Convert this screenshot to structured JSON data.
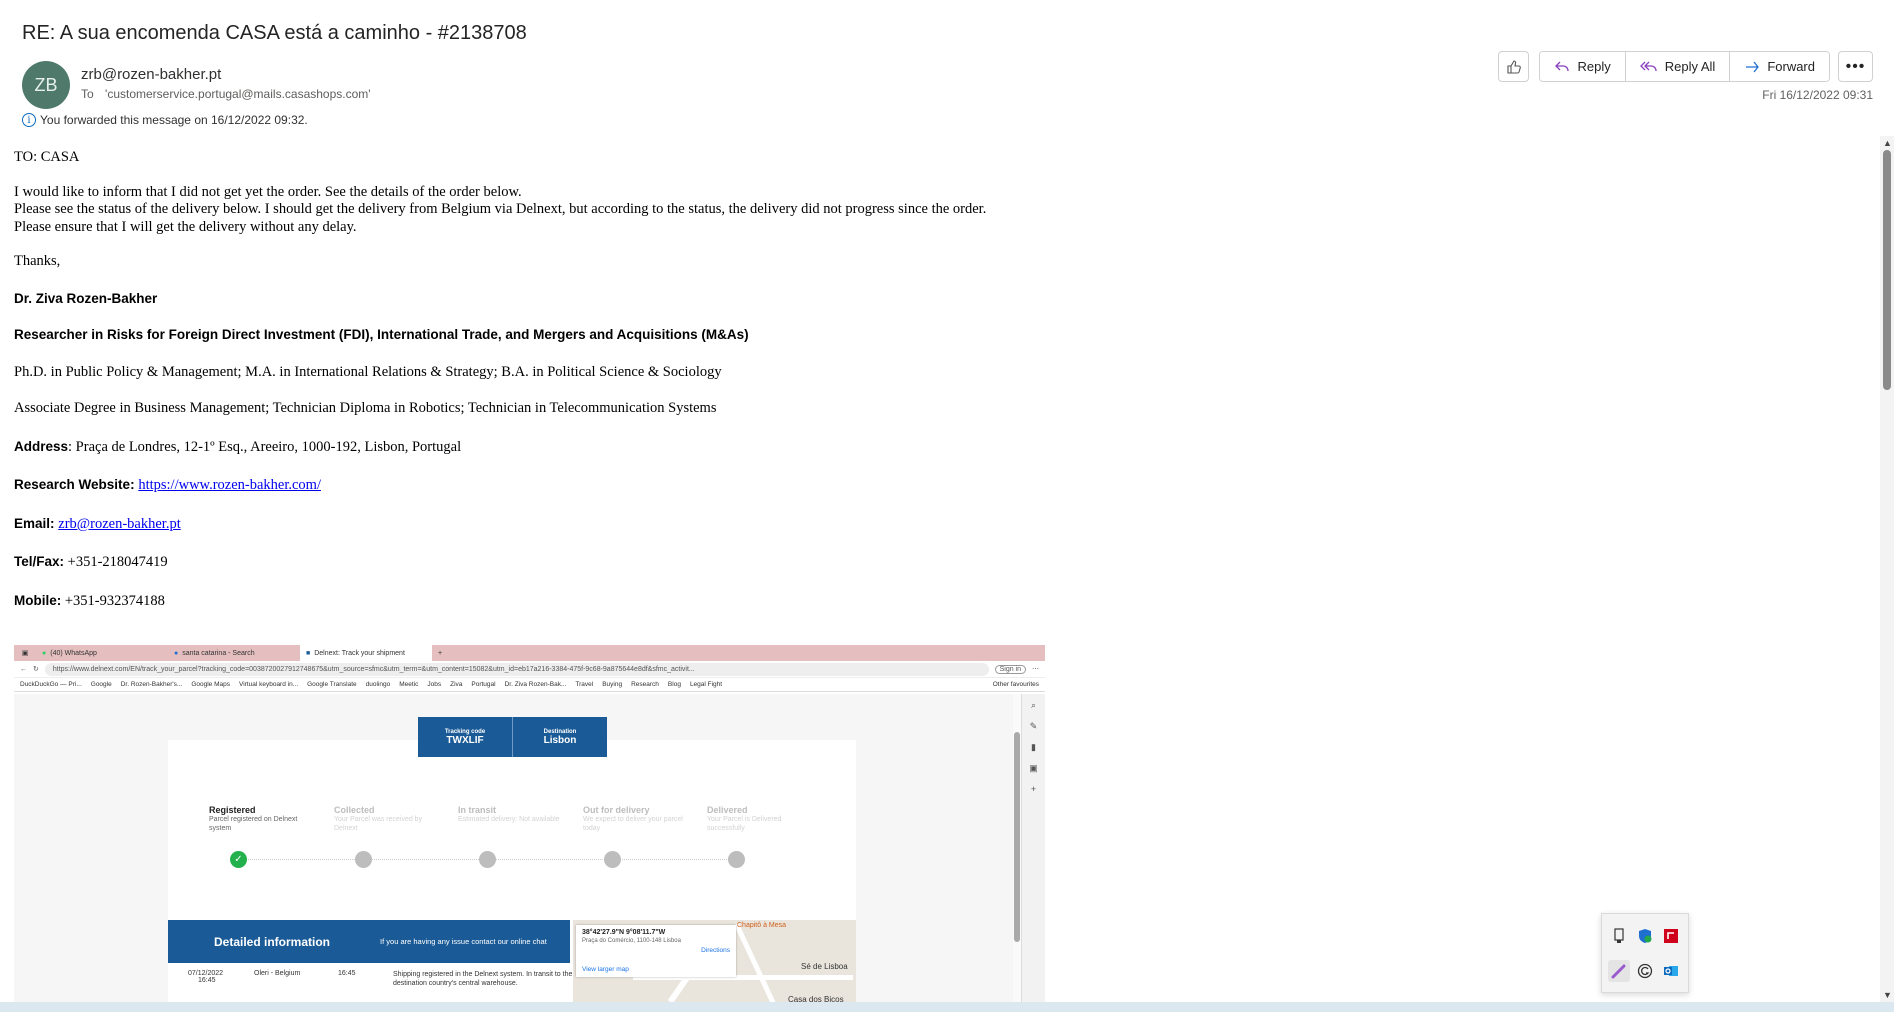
{
  "email": {
    "subject": "RE: A sua encomenda CASA está a caminho - #2138708",
    "avatar_initials": "ZB",
    "sender": "zrb@rozen-bakher.pt",
    "to_label": "To",
    "to_value": "'customerservice.portugal@mails.casashops.com'",
    "forward_notice": "You forwarded this message on 16/12/2022 09:32.",
    "date": "Fri 16/12/2022 09:31"
  },
  "toolbar": {
    "reply_label": "Reply",
    "reply_all_label": "Reply All",
    "forward_label": "Forward"
  },
  "body": {
    "greeting": "TO: CASA",
    "line1": "I would like to inform that I did not get yet the order. See the details of the order below.",
    "line2": "Please see the status of the delivery below. I should get the delivery from Belgium via Delnext, but according to the status, the delivery did not progress since the order.",
    "line3": "Please ensure that I will get the delivery without any delay.",
    "thanks": "Thanks,",
    "sig_name": "Dr. Ziva Rozen-Bakher",
    "sig_title": "Researcher in Risks for Foreign Direct Investment (FDI), International Trade, and Mergers and Acquisitions (M&As)",
    "sig_degrees": "Ph.D. in Public Policy & Management;  M.A. in International Relations & Strategy; B.A. in Political Science & Sociology",
    "sig_associate": "Associate Degree in Business Management; Technician Diploma in Robotics; Technician in Telecommunication Systems",
    "address_label": "Address",
    "address_value": ": Praça de Londres, 12-1º Esq., Areeiro, 1000-192, Lisbon, Portugal",
    "website_label": "Research Website",
    "website_value": "https://www.rozen-bakher.com/",
    "email_label": "Email",
    "email_value": "zrb@rozen-bakher.pt",
    "tel_label": "Tel/Fax:",
    "tel_value": " +351-218047419",
    "mobile_label": "Mobile:",
    "mobile_value": " +351-932374188"
  },
  "screenshot": {
    "tabs": [
      "(40) WhatsApp",
      "santa catarina - Search",
      "Delnext: Track your shipment"
    ],
    "url": "https://www.delnext.com/EN/track_your_parcel?tracking_code=0038720027912748675&utm_source=sfmc&utm_term=&utm_content=15082&utm_id=eb17a216-3384-475f-9c68-9a875644e8df&sfmc_activit...",
    "sign_in": "Sign in",
    "bookmarks": [
      "DuckDuckGo — Pri...",
      "Google",
      "Dr. Rozen-Bakher's...",
      "Google Maps",
      "Virtual keyboard in...",
      "Google Translate",
      "duolingo",
      "Meetic",
      "Jobs",
      "Ziva",
      "Portugal",
      "Dr. Ziva Rozen-Bak...",
      "Travel",
      "Buying",
      "Research",
      "Blog",
      "Legal Fight"
    ],
    "other_favourites": "Other favourites",
    "tracking_code_label": "Tracking code",
    "tracking_code": "TWXLIF",
    "destination_label": "Destination",
    "destination": "Lisbon",
    "steps": [
      {
        "title": "Registered",
        "desc": "Parcel registered on Delnext system"
      },
      {
        "title": "Collected",
        "desc": "Your Parcel was received by Delnext"
      },
      {
        "title": "In transit",
        "desc": "Estimated delivery: Not available"
      },
      {
        "title": "Out for delivery",
        "desc": "We expect to deliver your parcel today"
      },
      {
        "title": "Delivered",
        "desc": "Your Parcel is Delivered successfully"
      }
    ],
    "detailed_info": "Detailed information",
    "contact_chat": "If you are having any issue contact our online chat",
    "row": {
      "date": "07/12/2022",
      "time_small": "16:45",
      "location": "Oleri - Belgium",
      "time": "16:45",
      "desc": "Shipping registered in the Delnext system. In transit to the destination country's central warehouse."
    },
    "map": {
      "coords": "38°42'27.9\"N 9°08'11.7\"W",
      "address": "Praça do Comércio, 1100-148 Lisboa",
      "directions": "Directions",
      "larger": "View larger map",
      "label1": "Chapitô à Mesa",
      "label2": "Sé de Lisboa",
      "label3": "Casa dos Bicos"
    }
  }
}
